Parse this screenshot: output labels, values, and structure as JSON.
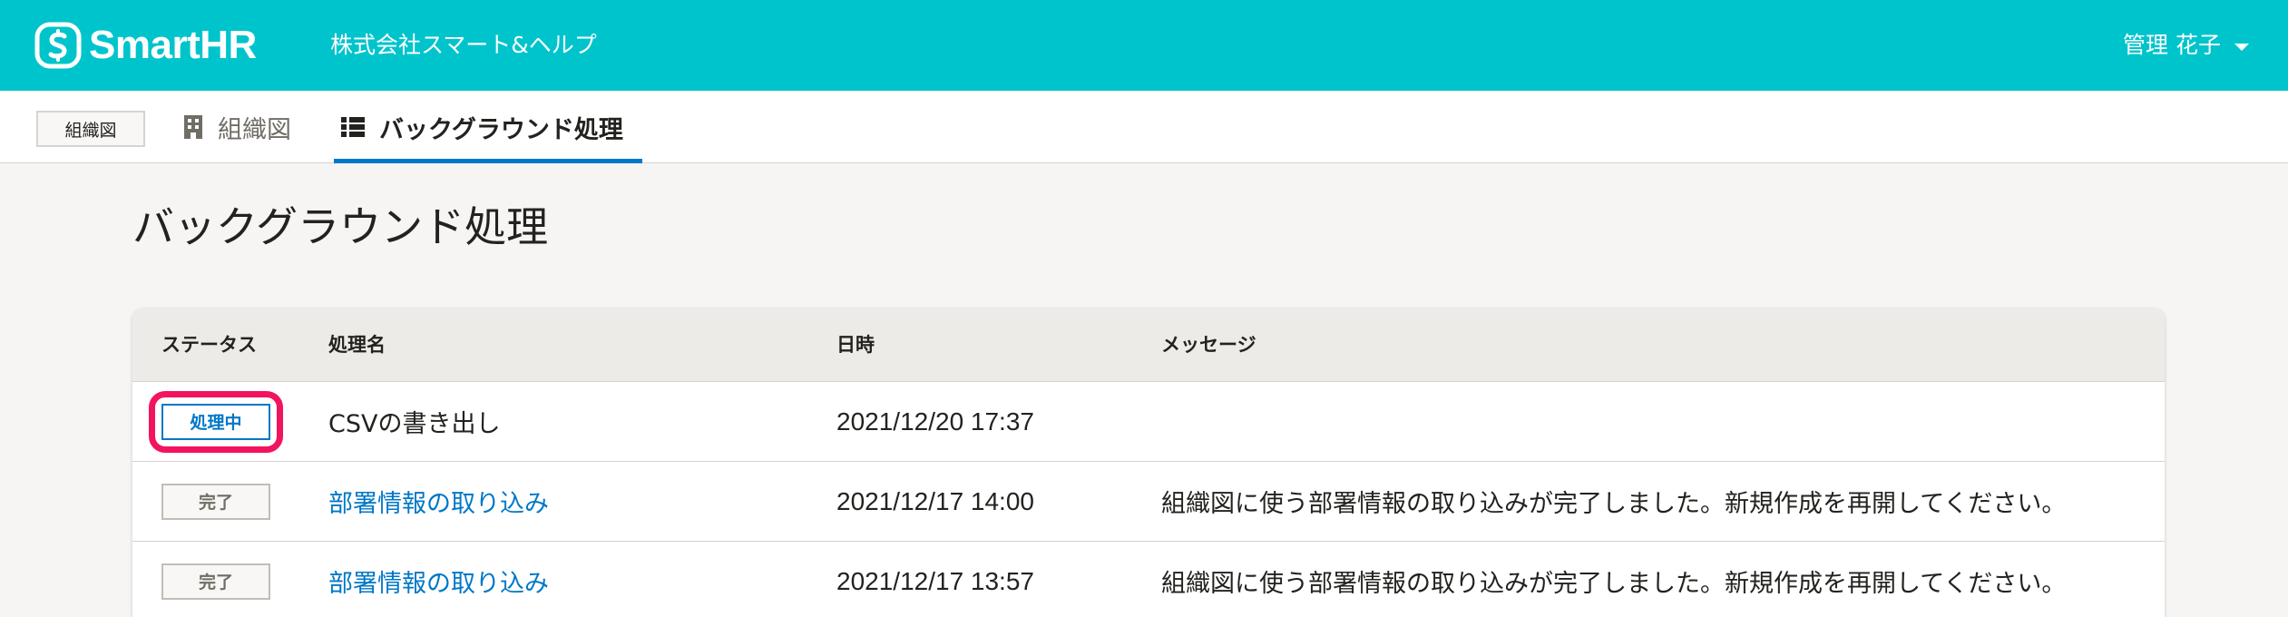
{
  "header": {
    "logo_text": "SmartHR",
    "company_name": "株式会社スマート&ヘルプ",
    "user_name": "管理 花子",
    "brand_color": "#00c4cc",
    "logo_icon": "smarthr-logo-icon",
    "caret_icon": "caret-down-icon"
  },
  "tabbar": {
    "app_chip": "組織図",
    "tabs": [
      {
        "label": "組織図",
        "icon": "building-icon",
        "active": false
      },
      {
        "label": "バックグラウンド処理",
        "icon": "list-icon",
        "active": true
      }
    ],
    "active_color": "#0077c7"
  },
  "page": {
    "title": "バックグラウンド処理"
  },
  "table": {
    "columns": [
      "ステータス",
      "処理名",
      "日時",
      "メッセージ"
    ],
    "rows": [
      {
        "status": "処理中",
        "name": "CSVの書き出し",
        "datetime": "2021/12/20 17:37",
        "message": ""
      },
      {
        "status": "完了",
        "name": "部署情報の取り込み",
        "datetime": "2021/12/17 14:00",
        "message": "組織図に使う部署情報の取り込みが完了しました。新規作成を再開してください。"
      },
      {
        "status": "完了",
        "name": "部署情報の取り込み",
        "datetime": "2021/12/17 13:57",
        "message": "組織図に使う部署情報の取り込みが完了しました。新規作成を再開してください。"
      }
    ],
    "highlight_color": "#f2145f"
  }
}
